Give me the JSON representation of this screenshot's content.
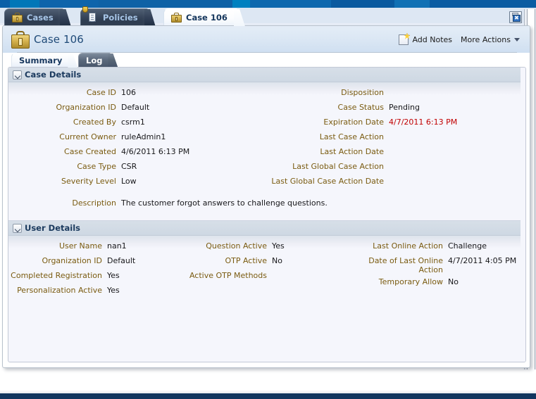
{
  "window": {
    "save_icon": "save-icon"
  },
  "tabs": [
    {
      "label": "Cases",
      "icon": "briefcase-icon",
      "active": false
    },
    {
      "label": "Policies",
      "icon": "policy-document-icon",
      "active": false
    },
    {
      "label": "Case 106",
      "icon": "briefcase-icon",
      "active": true
    }
  ],
  "header": {
    "title": "Case 106",
    "icon": "briefcase-icon",
    "add_notes_label": "Add Notes",
    "add_notes_icon": "note-add-icon",
    "more_actions_label": "More Actions",
    "more_actions_icon": "chevron-down-icon"
  },
  "subtabs": [
    {
      "label": "Summary",
      "active": true
    },
    {
      "label": "Log",
      "active": false
    }
  ],
  "case_details": {
    "section_title": "Case Details",
    "left": [
      {
        "label": "Case ID",
        "value": "106"
      },
      {
        "label": "Organization ID",
        "value": "Default"
      },
      {
        "label": "Created By",
        "value": "csrm1"
      },
      {
        "label": "Current Owner",
        "value": "ruleAdmin1"
      },
      {
        "label": "Case Created",
        "value": "4/6/2011 6:13 PM"
      },
      {
        "label": "Case Type",
        "value": "CSR"
      },
      {
        "label": "Severity Level",
        "value": "Low"
      }
    ],
    "right": [
      {
        "label": "Disposition",
        "value": ""
      },
      {
        "label": "Case Status",
        "value": "Pending"
      },
      {
        "label": "Expiration Date",
        "value": "4/7/2011 6:13 PM",
        "alert": true
      },
      {
        "label": "Last Case Action",
        "value": ""
      },
      {
        "label": "Last Action Date",
        "value": ""
      },
      {
        "label": "Last Global Case Action",
        "value": ""
      },
      {
        "label": "Last Global Case Action Date",
        "value": ""
      }
    ],
    "description": {
      "label": "Description",
      "value": "The customer forgot answers to challenge questions."
    }
  },
  "user_details": {
    "section_title": "User Details",
    "col1": [
      {
        "label": "User Name",
        "value": "nan1"
      },
      {
        "label": "Organization ID",
        "value": "Default"
      },
      {
        "label": "Completed Registration",
        "value": "Yes"
      },
      {
        "label": "Personalization Active",
        "value": "Yes"
      }
    ],
    "col2": [
      {
        "label": "Question Active",
        "value": "Yes"
      },
      {
        "label": "OTP Active",
        "value": "No"
      },
      {
        "label": "Active OTP Methods",
        "value": ""
      }
    ],
    "col3": [
      {
        "label": "Last Online Action",
        "value": "Challenge"
      },
      {
        "label": "Date of Last Online Action",
        "value": "4/7/2011 4:05 PM"
      },
      {
        "label": "Temporary Allow",
        "value": "No"
      }
    ]
  },
  "colors": {
    "label": "#7a5b10",
    "alert": "#c10000",
    "title": "#1f4a78",
    "section_title": "#1b3a5e"
  }
}
